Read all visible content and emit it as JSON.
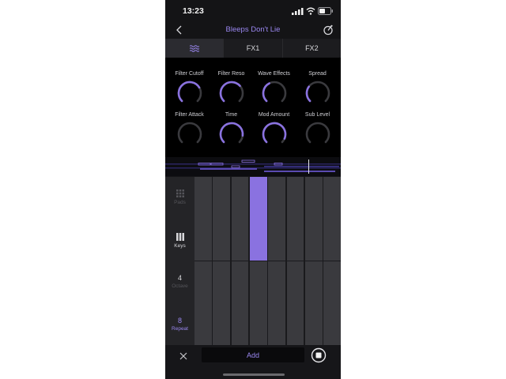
{
  "status": {
    "time": "13:23"
  },
  "header": {
    "title": "Bleeps Don't Lie"
  },
  "tabs": [
    {
      "label": "",
      "icon": "wave-icon",
      "active": true
    },
    {
      "label": "FX1",
      "active": false
    },
    {
      "label": "FX2",
      "active": false
    }
  ],
  "knobs": [
    {
      "label": "Filter Cutoff",
      "value": 0.72
    },
    {
      "label": "Filter Reso",
      "value": 0.68
    },
    {
      "label": "Wave Effects",
      "value": 0.4
    },
    {
      "label": "Spread",
      "value": 0.3
    },
    {
      "label": "Filter Attack",
      "value": 0.0
    },
    {
      "label": "Time",
      "value": 0.86
    },
    {
      "label": "Mod Amount",
      "value": 0.92
    },
    {
      "label": "Sub Level",
      "value": 0.0
    }
  ],
  "sidebar": {
    "pads": {
      "label": "Pads"
    },
    "keys": {
      "label": "Keys"
    },
    "octave": {
      "value": "4",
      "label": "Octave"
    },
    "repeat": {
      "value": "8",
      "label": "Repeat"
    }
  },
  "grid": {
    "cols": 8,
    "rows": 2,
    "active": [
      [
        0,
        3
      ]
    ]
  },
  "bottom": {
    "add_label": "Add"
  },
  "colors": {
    "accent": "#8a72e0",
    "background": "#141416",
    "pad": "#3a3a3e"
  }
}
